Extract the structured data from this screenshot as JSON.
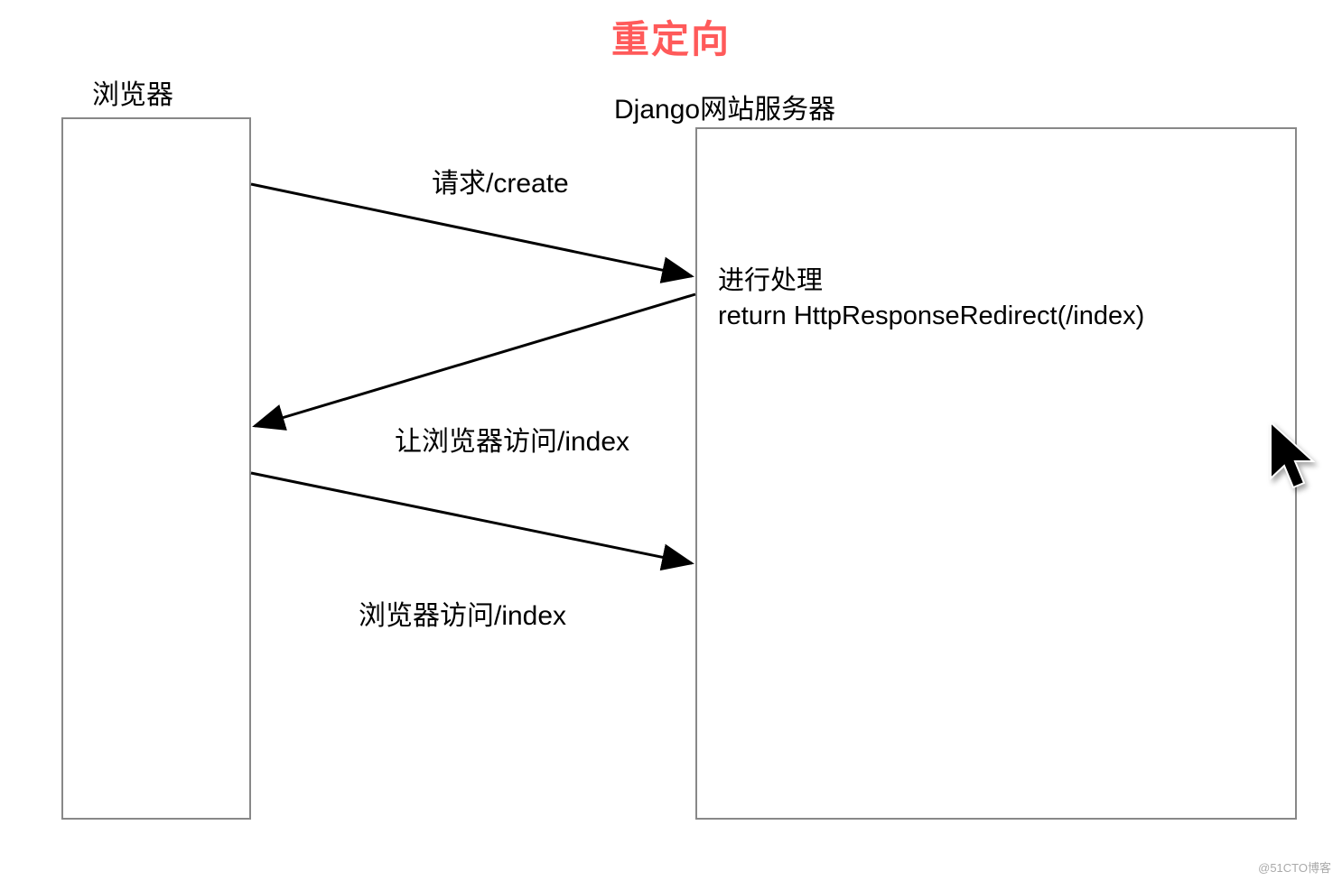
{
  "title": "重定向",
  "title_color": "#ff5a5a",
  "browser_label": "浏览器",
  "server_label": "Django网站服务器",
  "arrows": {
    "request_label": "请求/create",
    "redirect_label": "让浏览器访问/index",
    "visit_label": "浏览器访问/index"
  },
  "server_text": {
    "line1": "进行处理",
    "line2": "return HttpResponseRedirect(/index)"
  },
  "watermark": "@51CTO博客"
}
